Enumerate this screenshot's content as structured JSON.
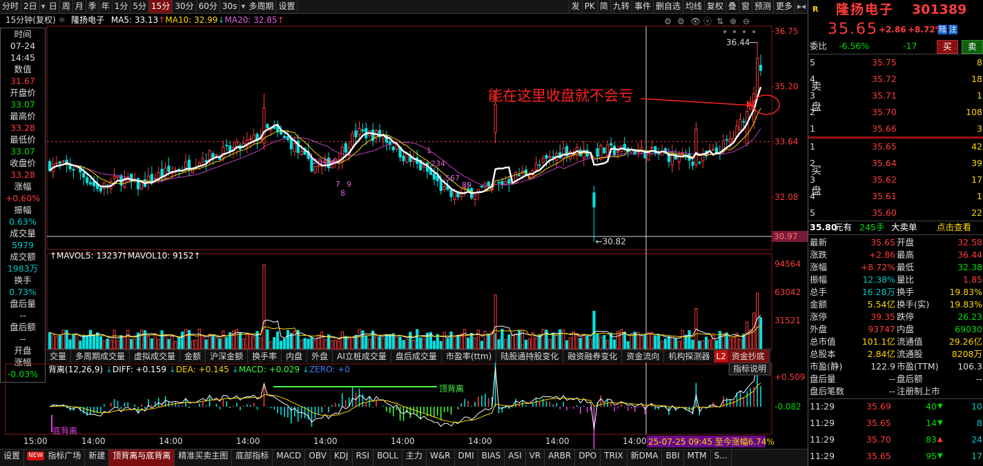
{
  "toolbar": {
    "left": [
      "分时",
      "2日",
      "日",
      "周",
      "月",
      "季",
      "年",
      "1分",
      "5分",
      "15分",
      "30分",
      "60分",
      "30s",
      "多周期",
      "设置"
    ],
    "active": "15分",
    "right": [
      "发",
      "PK",
      "简",
      "九转",
      "事件",
      "删自选",
      "均线",
      "复权",
      "叠",
      "窗",
      "预测",
      "更多"
    ]
  },
  "info": {
    "period": "15分钟(复权)",
    "name": "隆扬电子",
    "ma5": "MA5: 33.13",
    "ma10": "MA10: 32.99",
    "ma20": "MA20: 32.85"
  },
  "left_panel": [
    {
      "label": "时间",
      "value": "07-24"
    },
    {
      "label": "",
      "value": "14:45",
      "vcolor": "w"
    },
    {
      "label": "数值",
      "value": "31.67",
      "vcolor": "r"
    },
    {
      "label": "开盘价",
      "value": "33.07",
      "vcolor": "g"
    },
    {
      "label": "最高价",
      "value": "33.28",
      "vcolor": "r"
    },
    {
      "label": "最低价",
      "value": "33.07",
      "vcolor": "g"
    },
    {
      "label": "收盘价",
      "value": "33.28",
      "vcolor": "r"
    },
    {
      "label": "涨幅",
      "value": "+0.60%",
      "vcolor": "r"
    },
    {
      "label": "振幅",
      "value": "0.63%",
      "vcolor": "c"
    },
    {
      "label": "成交量",
      "value": "5979",
      "vcolor": "c"
    },
    {
      "label": "成交额",
      "value": "1983万",
      "vcolor": "c"
    },
    {
      "label": "换手",
      "value": "0.73%",
      "vcolor": "c"
    },
    {
      "label": "盘后量",
      "value": "--",
      "vcolor": "w"
    },
    {
      "label": "盘后额",
      "value": "--",
      "vcolor": "w"
    },
    {
      "label": "开盘",
      "value": "",
      "vcolor": "w"
    },
    {
      "label": "涨幅",
      "value": "-0.03%",
      "vcolor": "g"
    }
  ],
  "main_chart": {
    "price_axis": [
      "36.75",
      "35.20",
      "33.64",
      "32.08"
    ],
    "current_price": "30.97",
    "high_label": "36.44",
    "low_label": "30.82",
    "annotation": "能在这里收盘就不会亏",
    "seq_marks_1": [
      "1",
      "2",
      "3",
      "4",
      "5",
      "6",
      "7",
      "9",
      "8"
    ],
    "seq_marks_2": [
      "1",
      "2",
      "3",
      "4",
      "5",
      "6",
      "7",
      "8",
      "9"
    ]
  },
  "volume_chart": {
    "label_mavol5": "MAVOL5: 13237",
    "label_mavol10": "MAVOL10: 9152",
    "axis": [
      "94564",
      "63042",
      "31521"
    ]
  },
  "tabs": [
    "交量",
    "多周期成交量",
    "虚拟成交量",
    "金额",
    "沪深金额",
    "换手率",
    "内盘",
    "外盘",
    "AI立桩成交量",
    "盘后成交量",
    "市盈率(ttm)",
    "陆股通持股变化",
    "融资融券变化",
    "资金流向",
    "机构探测器",
    "资金抄底"
  ],
  "active_tab": "资金抄底",
  "tab_badge": "L2",
  "macd": {
    "title": "背离(12,26,9)",
    "diff": "DIFF: +0.159",
    "dea": "DEA: +0.145",
    "macd": "MACD: +0.029",
    "zero": "ZERO: +0",
    "axis": [
      "+0.509",
      "-0.082"
    ],
    "top_div": "顶背离",
    "bottom_div": "底背离",
    "button": "指标说明"
  },
  "time_axis": [
    "15:00",
    "14:00",
    "14:00",
    "14:00",
    "14:00",
    "14:00",
    "14:00",
    "14:00",
    "14:00"
  ],
  "time_highlight": "25-07-25 09:45 至今涨幅6.74%",
  "bottom_bar": [
    "设置",
    "指标广场",
    "新建",
    "顶背离与底背离",
    "精准买卖主图",
    "底部指标",
    "MACD",
    "OBV",
    "KDJ",
    "RSI",
    "BOLL",
    "主力",
    "W&R",
    "DMI",
    "BIAS",
    "ASI",
    "VR",
    "ARBR",
    "DPO",
    "TRIX",
    "新DMA",
    "BBI",
    "MTM",
    "S..."
  ],
  "bottom_active": "顶背离与底背离",
  "new_badge": "NEW",
  "quote": {
    "name": "隆扬电子",
    "code": "301389",
    "price": "35.65",
    "change": "+2.86",
    "pct": "+8.72%",
    "tags": [
      "陆",
      "注"
    ],
    "webi_label": "委比",
    "webi": "-6.56%",
    "weicha": "-17",
    "buy_btn": "买",
    "sell_btn": "卖",
    "sell_side_label": "卖盘",
    "buy_side_label": "买盘",
    "sell": [
      {
        "lvl": "5",
        "price": "35.75",
        "vol": "8"
      },
      {
        "lvl": "4",
        "price": "35.72",
        "vol": "18"
      },
      {
        "lvl": "3",
        "price": "35.71",
        "vol": "1"
      },
      {
        "lvl": "2",
        "price": "35.70",
        "vol": "108"
      },
      {
        "lvl": "1",
        "price": "35.66",
        "vol": "3"
      }
    ],
    "buy": [
      {
        "lvl": "1",
        "price": "35.65",
        "vol": "42"
      },
      {
        "lvl": "2",
        "price": "35.64",
        "vol": "39"
      },
      {
        "lvl": "3",
        "price": "35.62",
        "vol": "17"
      },
      {
        "lvl": "4",
        "price": "35.61",
        "vol": "1"
      },
      {
        "lvl": "5",
        "price": "35.60",
        "vol": "22"
      }
    ],
    "big_order": {
      "price": "35.80",
      "unit": "元有",
      "vol": "245手",
      "label": "大卖单",
      "link": "点击查看"
    },
    "stats": [
      [
        "最新",
        "35.65",
        "r",
        "开盘",
        "32.58",
        "r"
      ],
      [
        "涨跌",
        "+2.86",
        "r",
        "最高",
        "36.44",
        "r"
      ],
      [
        "涨幅",
        "+8.72%",
        "r",
        "最低",
        "32.38",
        "g"
      ],
      [
        "振幅",
        "12.38%",
        "c",
        "量比",
        "1.85",
        "r"
      ],
      [
        "总手",
        "16.28万",
        "c",
        "换手",
        "19.83%",
        "y"
      ],
      [
        "金额",
        "5.54亿",
        "y",
        "换手(实)",
        "19.83%",
        "y"
      ],
      [
        "涨停",
        "39.35",
        "r",
        "跌停",
        "26.23",
        "g"
      ],
      [
        "外盘",
        "93747",
        "r",
        "内盘",
        "69030",
        "g"
      ],
      [
        "总市值",
        "101.1亿",
        "y",
        "流通值",
        "29.26亿",
        "y"
      ],
      [
        "总股本",
        "2.84亿",
        "y",
        "流通股",
        "8208万",
        "y"
      ],
      [
        "市盈(静)",
        "122.9",
        "w",
        "市盈(TTM)",
        "106.3",
        "w"
      ],
      [
        "盘后量",
        "--",
        "w",
        "盘后额",
        "--",
        "w"
      ],
      [
        "盘后笔数",
        "--",
        "w",
        "注册制上市",
        "",
        "w"
      ]
    ],
    "ticks": [
      {
        "time": "11:29",
        "price": "35.69",
        "vol": "40",
        "dir": "down",
        "n": "10"
      },
      {
        "time": "11:29",
        "price": "35.65",
        "vol": "14",
        "dir": "down",
        "n": "8"
      },
      {
        "time": "11:29",
        "price": "35.70",
        "vol": "83",
        "dir": "up",
        "n": "24"
      },
      {
        "time": "11:29",
        "price": "35.65",
        "vol": "95",
        "dir": "down",
        "n": "17"
      }
    ]
  }
}
